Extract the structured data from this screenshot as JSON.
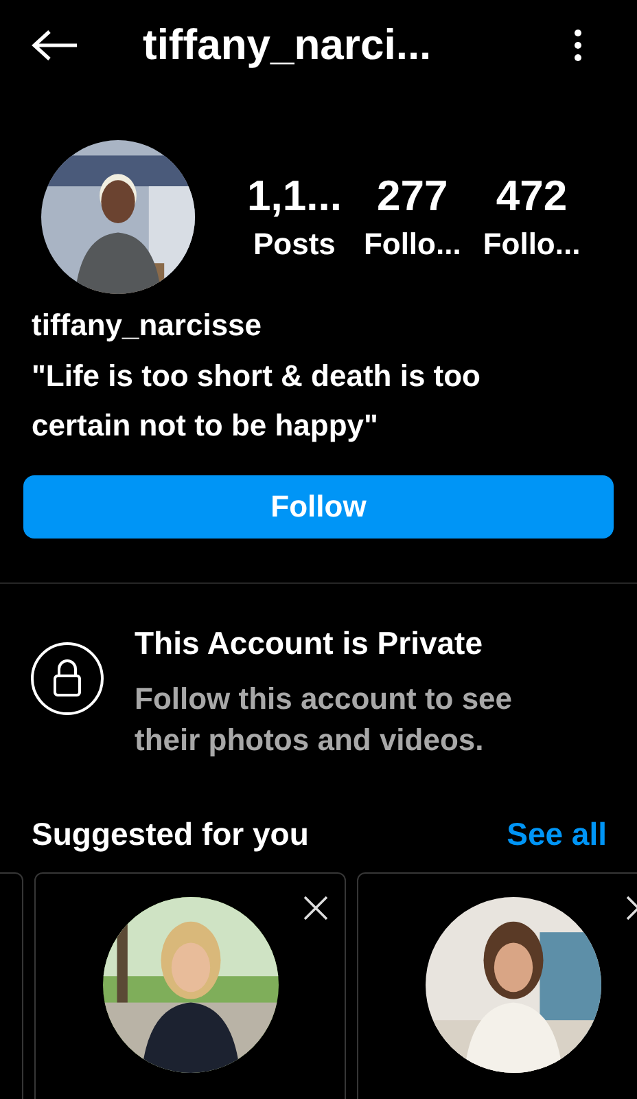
{
  "header": {
    "title": "tiffany_narci..."
  },
  "profile": {
    "username": "tiffany_narcisse",
    "bio": "\"Life is too short & death is too certain not to be happy\""
  },
  "stats": [
    {
      "value": "1,1...",
      "label": "Posts"
    },
    {
      "value": "277",
      "label": "Follo..."
    },
    {
      "value": "472",
      "label": "Follo..."
    }
  ],
  "follow_button": {
    "label": "Follow"
  },
  "private_notice": {
    "title": "This Account is Private",
    "message": "Follow this account to see their photos and videos."
  },
  "suggested": {
    "title": "Suggested for you",
    "see_all": "See all",
    "cards": [
      {
        "kind": "partial"
      },
      {
        "kind": "card"
      },
      {
        "kind": "card"
      }
    ]
  }
}
